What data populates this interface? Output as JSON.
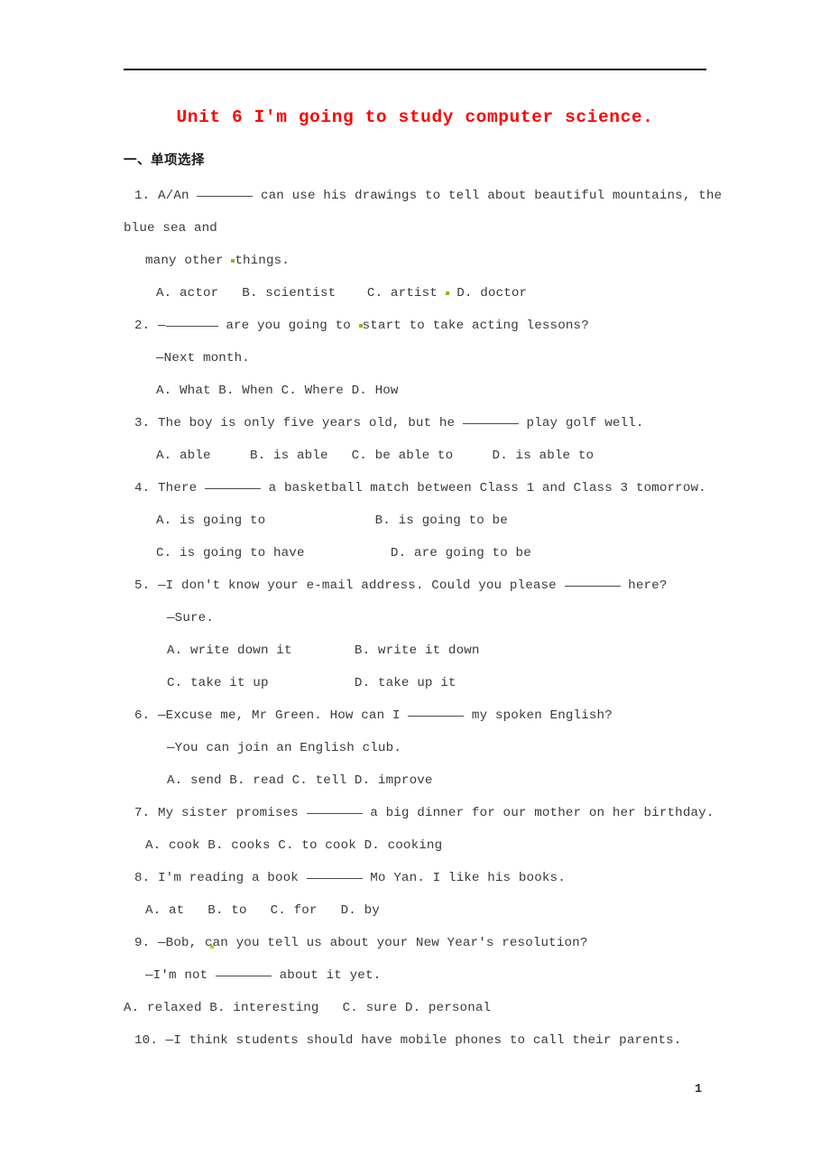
{
  "document": {
    "title": "Unit 6 I'm going to study computer science.",
    "title_color": "#ff0000",
    "page_number": "1",
    "section_heading": "一、单项选择"
  },
  "lines": [
    {
      "id": "q1a_pre",
      "text": "1. A/An "
    },
    {
      "id": "q1a_post",
      "text": " can use his drawings to tell about beautiful mountains, the"
    },
    {
      "id": "q1b",
      "text": "blue sea and"
    },
    {
      "id": "q1c_pre",
      "text": "many other "
    },
    {
      "id": "q1c_post",
      "text": "things."
    },
    {
      "id": "q1_opt_a",
      "text": "A. actor   B. scientist    C. artist "
    },
    {
      "id": "q1_opt_b",
      "text": " D. doctor"
    },
    {
      "id": "q2_pre",
      "text": "2. —"
    },
    {
      "id": "q2_post",
      "text": " are you going to "
    },
    {
      "id": "q2_post2",
      "text": "start to take acting lessons?"
    },
    {
      "id": "q2_ans",
      "text": "—Next month."
    },
    {
      "id": "q2_opts",
      "text": "A. What B. When C. Where D. How"
    },
    {
      "id": "q3_pre",
      "text": "3. The boy is only five years old, but he "
    },
    {
      "id": "q3_post",
      "text": " play golf well."
    },
    {
      "id": "q3_opts",
      "text": "A. able     B. is able   C. be able to     D. is able to"
    },
    {
      "id": "q4_pre",
      "text": "4. There "
    },
    {
      "id": "q4_post",
      "text": " a basketball match between Class 1 and Class 3 tomorrow."
    },
    {
      "id": "q4_ab",
      "text": "A. is going to              B. is going to be"
    },
    {
      "id": "q4_cd",
      "text": "C. is going to have           D. are going to be"
    },
    {
      "id": "q5_pre",
      "text": "5. —I don't know your e-mail address. Could you please "
    },
    {
      "id": "q5_post",
      "text": " here?"
    },
    {
      "id": "q5_ans",
      "text": "—Sure."
    },
    {
      "id": "q5_ab",
      "text": "A. write down it        B. write it down"
    },
    {
      "id": "q5_cd",
      "text": "C. take it up           D. take up it"
    },
    {
      "id": "q6_pre",
      "text": "6. —Excuse me, Mr Green. How can I "
    },
    {
      "id": "q6_post",
      "text": " my spoken English?"
    },
    {
      "id": "q6_ans",
      "text": "—You can join an English club."
    },
    {
      "id": "q6_opts",
      "text": "A. send B. read C. tell D. improve"
    },
    {
      "id": "q7_pre",
      "text": "7. My sister promises "
    },
    {
      "id": "q7_post",
      "text": " a big dinner for our mother on her birthday."
    },
    {
      "id": "q7_opts",
      "text": "A. cook B. cooks C. to cook D. cooking"
    },
    {
      "id": "q8_pre",
      "text": "8. I'm reading a book "
    },
    {
      "id": "q8_post",
      "text": " Mo Yan. I like his books."
    },
    {
      "id": "q8_opts",
      "text": "A. at   B. to   C. for   D. by"
    },
    {
      "id": "q9_pre",
      "text": "9. —Bob, c"
    },
    {
      "id": "q9_post",
      "text": "an you tell us about your New Year's resolution?"
    },
    {
      "id": "q9_ans_pre",
      "text": "—I'm not "
    },
    {
      "id": "q9_ans_post",
      "text": " about it yet."
    },
    {
      "id": "q9_opts",
      "text": "A. relaxed B. interesting   C. sure D. personal"
    },
    {
      "id": "q10",
      "text": "10. —I think students should have mobile phones to call their parents."
    }
  ]
}
